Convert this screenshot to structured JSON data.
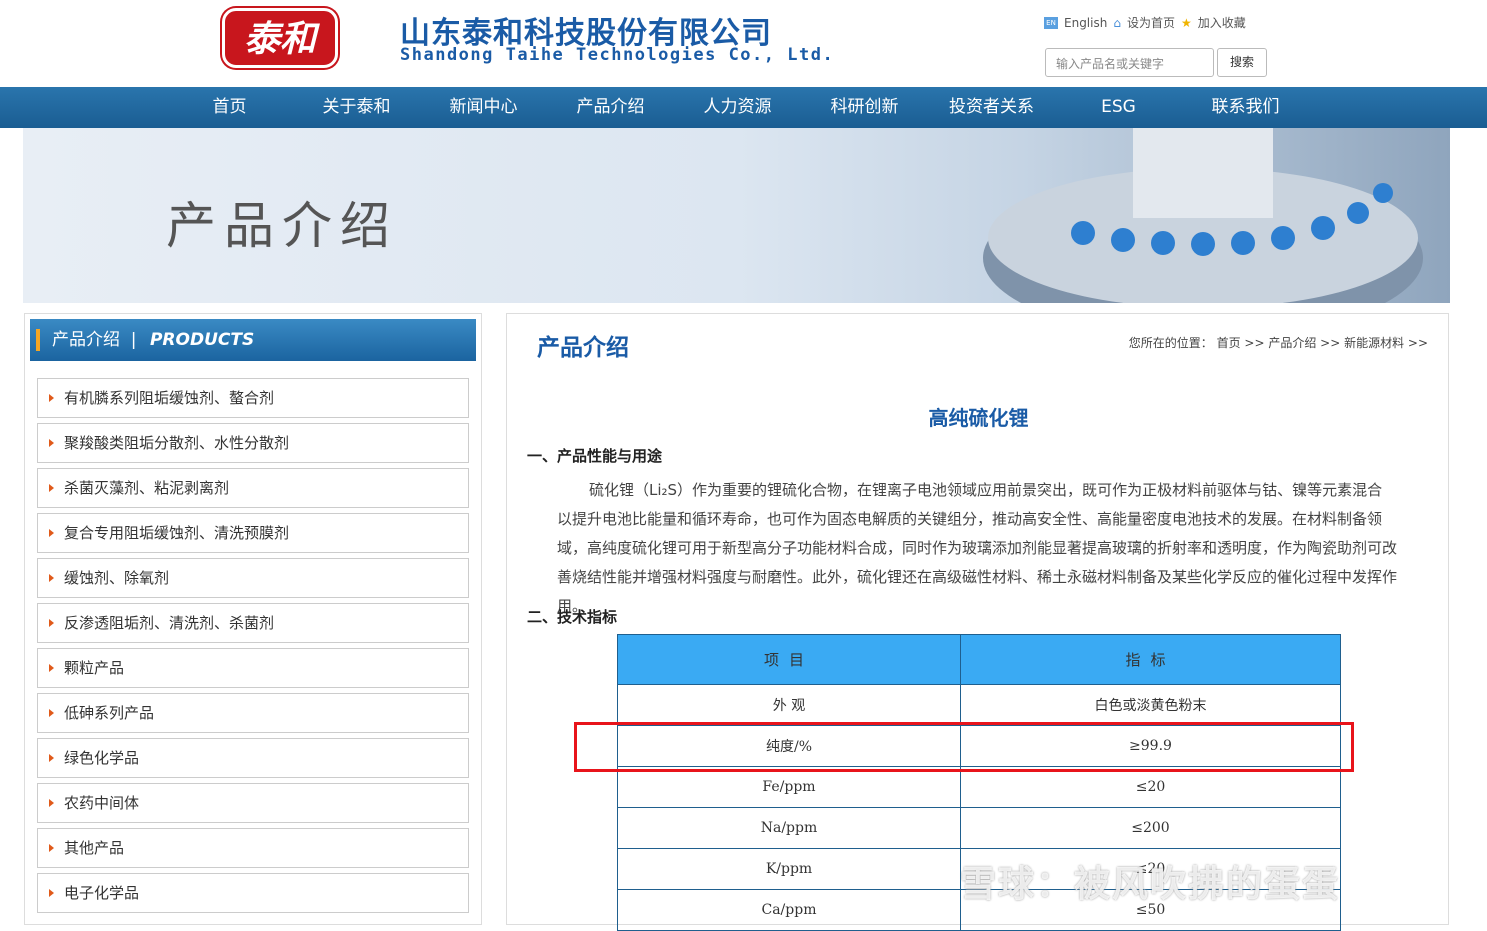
{
  "header": {
    "logo": "泰和",
    "cn_name": "山东泰和科技股份有限公司",
    "en_name": "Shandong Taihe Technologies Co., Ltd.",
    "links": [
      "English",
      "设为首页",
      "加入收藏"
    ],
    "search_placeholder": "输入产品名或关键字",
    "search_button": "搜索"
  },
  "nav": [
    "首页",
    "关于泰和",
    "新闻中心",
    "产品介绍",
    "人力资源",
    "科研创新",
    "投资者关系",
    "ESG",
    "联系我们"
  ],
  "banner": {
    "title": "产品介绍"
  },
  "sidebar": {
    "title": "产品介绍",
    "title_en": "PRODUCTS",
    "items": [
      "有机膦系列阻垢缓蚀剂、螯合剂",
      "聚羧酸类阻垢分散剂、水性分散剂",
      "杀菌灭藻剂、粘泥剥离剂",
      "复合专用阻垢缓蚀剂、清洗预膜剂",
      "缓蚀剂、除氧剂",
      "反渗透阻垢剂、清洗剂、杀菌剂",
      "颗粒产品",
      "低砷系列产品",
      "绿色化学品",
      "农药中间体",
      "其他产品",
      "电子化学品"
    ]
  },
  "main": {
    "title": "产品介绍",
    "breadcrumb": "您所在的位置： 首页 >> 产品介绍 >> 新能源材料 >>",
    "product": "高纯硫化锂",
    "sec1": "一、产品性能与用途",
    "para": "硫化锂（Li₂S）作为重要的锂硫化合物，在锂离子电池领域应用前景突出，既可作为正极材料前驱体与钴、镍等元素混合以提升电池比能量和循环寿命，也可作为固态电解质的关键组分，推动高安全性、高能量密度电池技术的发展。在材料制备领域，高纯度硫化锂可用于新型高分子功能材料合成，同时作为玻璃添加剂能显著提高玻璃的折射率和透明度，作为陶瓷助剂可改善烧结性能并增强材料强度与耐磨性。此外，硫化锂还在高级磁性材料、稀土永磁材料制备及某些化学反应的催化过程中发挥作用。",
    "sec2": "二、技术指标",
    "table": {
      "headers": [
        "项目",
        "指标"
      ],
      "rows": [
        [
          "外 观",
          "白色或淡黄色粉末"
        ],
        [
          "纯度/%",
          "≥99.9"
        ],
        [
          "Fe/ppm",
          "≤20"
        ],
        [
          "Na/ppm",
          "≤200"
        ],
        [
          "K/ppm",
          "≤20"
        ],
        [
          "Ca/ppm",
          "≤50"
        ]
      ]
    }
  },
  "watermark": "雪球：被风吹拂的蛋蛋"
}
